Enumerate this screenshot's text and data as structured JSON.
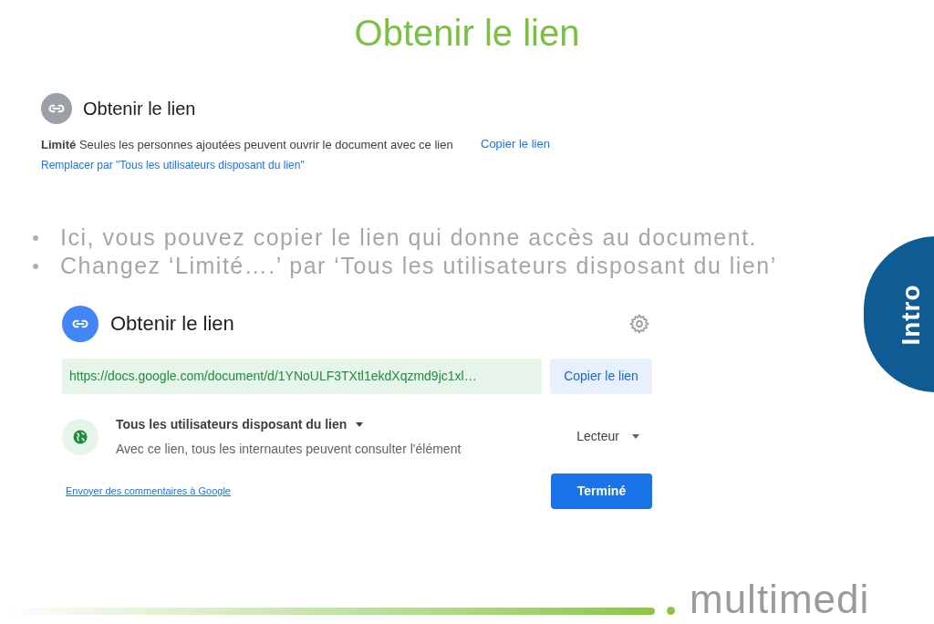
{
  "slide_title": "Obtenir le lien",
  "restricted_panel": {
    "title": "Obtenir le lien",
    "access_label": "Limité",
    "access_text": "Seules les personnes ajoutées peuvent ouvrir le document avec ce lien",
    "change_link": "Remplacer par \"Tous les utilisateurs disposant du lien\"",
    "copy_link": "Copier le lien"
  },
  "bullets": [
    "Ici, vous pouvez copier le lien qui donne accès au document.",
    "Changez ‘Limité….’ par ‘Tous les utilisateurs disposant du lien’"
  ],
  "side_tab": "Intro",
  "share_dialog": {
    "title": "Obtenir le lien",
    "url": "https://docs.google.com/document/d/1YNoULF3TXtl1ekdXqzmd9jc1xl…",
    "copy_button": "Copier le lien",
    "access": "Tous les utilisateurs disposant du lien",
    "access_description": "Avec ce lien, tous les internautes peuvent consulter l'élément",
    "role": "Lecteur",
    "feedback_link": "Envoyer des commentaires à Google",
    "done_button": "Terminé"
  },
  "logo": "multimedi"
}
